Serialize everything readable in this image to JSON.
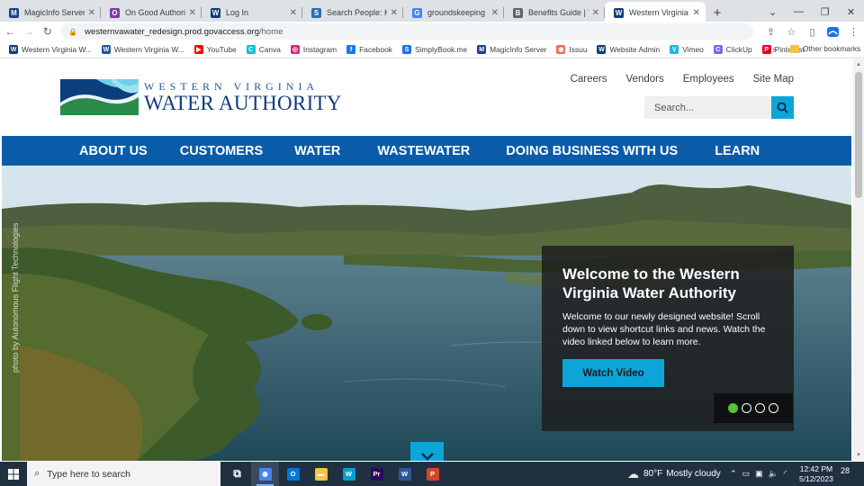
{
  "browser": {
    "tabs": [
      {
        "label": "MagicInfo Server",
        "icon": "magicinfo-icon",
        "color": "#1d3f8a",
        "glyph": "M"
      },
      {
        "label": "On Good Authority M",
        "icon": "authority-icon",
        "color": "#7a3aa8",
        "glyph": "O"
      },
      {
        "label": "Log In",
        "icon": "wvwa-icon",
        "color": "#123b7a",
        "glyph": "W"
      },
      {
        "label": "Search People: Kenne",
        "icon": "people-icon",
        "color": "#2b6cb0",
        "glyph": "S"
      },
      {
        "label": "groundskeeping - Go",
        "icon": "google-icon",
        "color": "#4285f4",
        "glyph": "G"
      },
      {
        "label": "Benefits Guide | West",
        "icon": "benefits-icon",
        "color": "#5f6368",
        "glyph": "B"
      },
      {
        "label": "Western Virginia Wat",
        "icon": "wvwa-icon",
        "color": "#123b7a",
        "glyph": "W",
        "active": true
      }
    ],
    "new_tab": "+",
    "url_host": "westernvawater_redesign.prod.govaccess.org",
    "url_path": "/home",
    "bookmarks": [
      {
        "label": "Western Virginia W...",
        "color": "#123b7a",
        "glyph": "W"
      },
      {
        "label": "Western Virginia W...",
        "color": "#1d5a9a",
        "glyph": "W"
      },
      {
        "label": "YouTube",
        "color": "#ff0000",
        "glyph": "▶"
      },
      {
        "label": "Canva",
        "color": "#00c4cc",
        "glyph": "C"
      },
      {
        "label": "Instagram",
        "color": "#d62976",
        "glyph": "◎"
      },
      {
        "label": "Facebook",
        "color": "#1877f2",
        "glyph": "f"
      },
      {
        "label": "SimplyBook.me",
        "color": "#1a73e8",
        "glyph": "S"
      },
      {
        "label": "MagicInfo Server",
        "color": "#1d3f8a",
        "glyph": "M"
      },
      {
        "label": "Issuu",
        "color": "#f36d5d",
        "glyph": "◉"
      },
      {
        "label": "Website Admin",
        "color": "#123b7a",
        "glyph": "W"
      },
      {
        "label": "Vimeo",
        "color": "#1ab7ea",
        "glyph": "V"
      },
      {
        "label": "ClickUp",
        "color": "#7b68ee",
        "glyph": "C"
      },
      {
        "label": "Pinterest",
        "color": "#e60023",
        "glyph": "P"
      }
    ],
    "bookmarks_more": "»",
    "other_bookmarks": "Other bookmarks"
  },
  "site": {
    "logo_top": "Western Virginia",
    "logo_bottom": "WATER AUTHORITY",
    "util_links": [
      "Careers",
      "Vendors",
      "Employees",
      "Site Map"
    ],
    "search_placeholder": "Search...",
    "nav": [
      "ABOUT US",
      "CUSTOMERS",
      "WATER",
      "WASTEWATER",
      "DOING BUSINESS WITH US",
      "LEARN"
    ],
    "photo_credit": "photo by Autonomous Flight Technologies",
    "hero_title": "Welcome to the Western Virginia Water Authority",
    "hero_body": "Welcome to our newly designed website! Scroll down to view shortcut links and news. Watch the video linked below to learn more.",
    "hero_button": "Watch Video",
    "slides_count": 4,
    "active_slide": 1,
    "accent_color": "#0da5d8",
    "nav_color": "#0a5ca8"
  },
  "taskbar": {
    "search_placeholder": "Type here to search",
    "apps": [
      {
        "name": "task-view-icon",
        "color": "transparent",
        "glyph": "⧉"
      },
      {
        "name": "chrome-icon",
        "color": "#4285f4",
        "glyph": "◉",
        "active": true
      },
      {
        "name": "outlook-icon",
        "color": "#0078d4",
        "glyph": "O"
      },
      {
        "name": "file-explorer-icon",
        "color": "#f4c542",
        "glyph": "▬"
      },
      {
        "name": "webex-icon",
        "color": "#00a0d1",
        "glyph": "W"
      },
      {
        "name": "premiere-icon",
        "color": "#2a0a5e",
        "glyph": "Pr"
      },
      {
        "name": "word-icon",
        "color": "#2b579a",
        "glyph": "W"
      },
      {
        "name": "powerpoint-icon",
        "color": "#d24726",
        "glyph": "P"
      }
    ],
    "weather_temp": "80°F",
    "weather_desc": "Mostly cloudy",
    "time": "12:42 PM",
    "date": "5/12/2023",
    "notifications": "28"
  }
}
